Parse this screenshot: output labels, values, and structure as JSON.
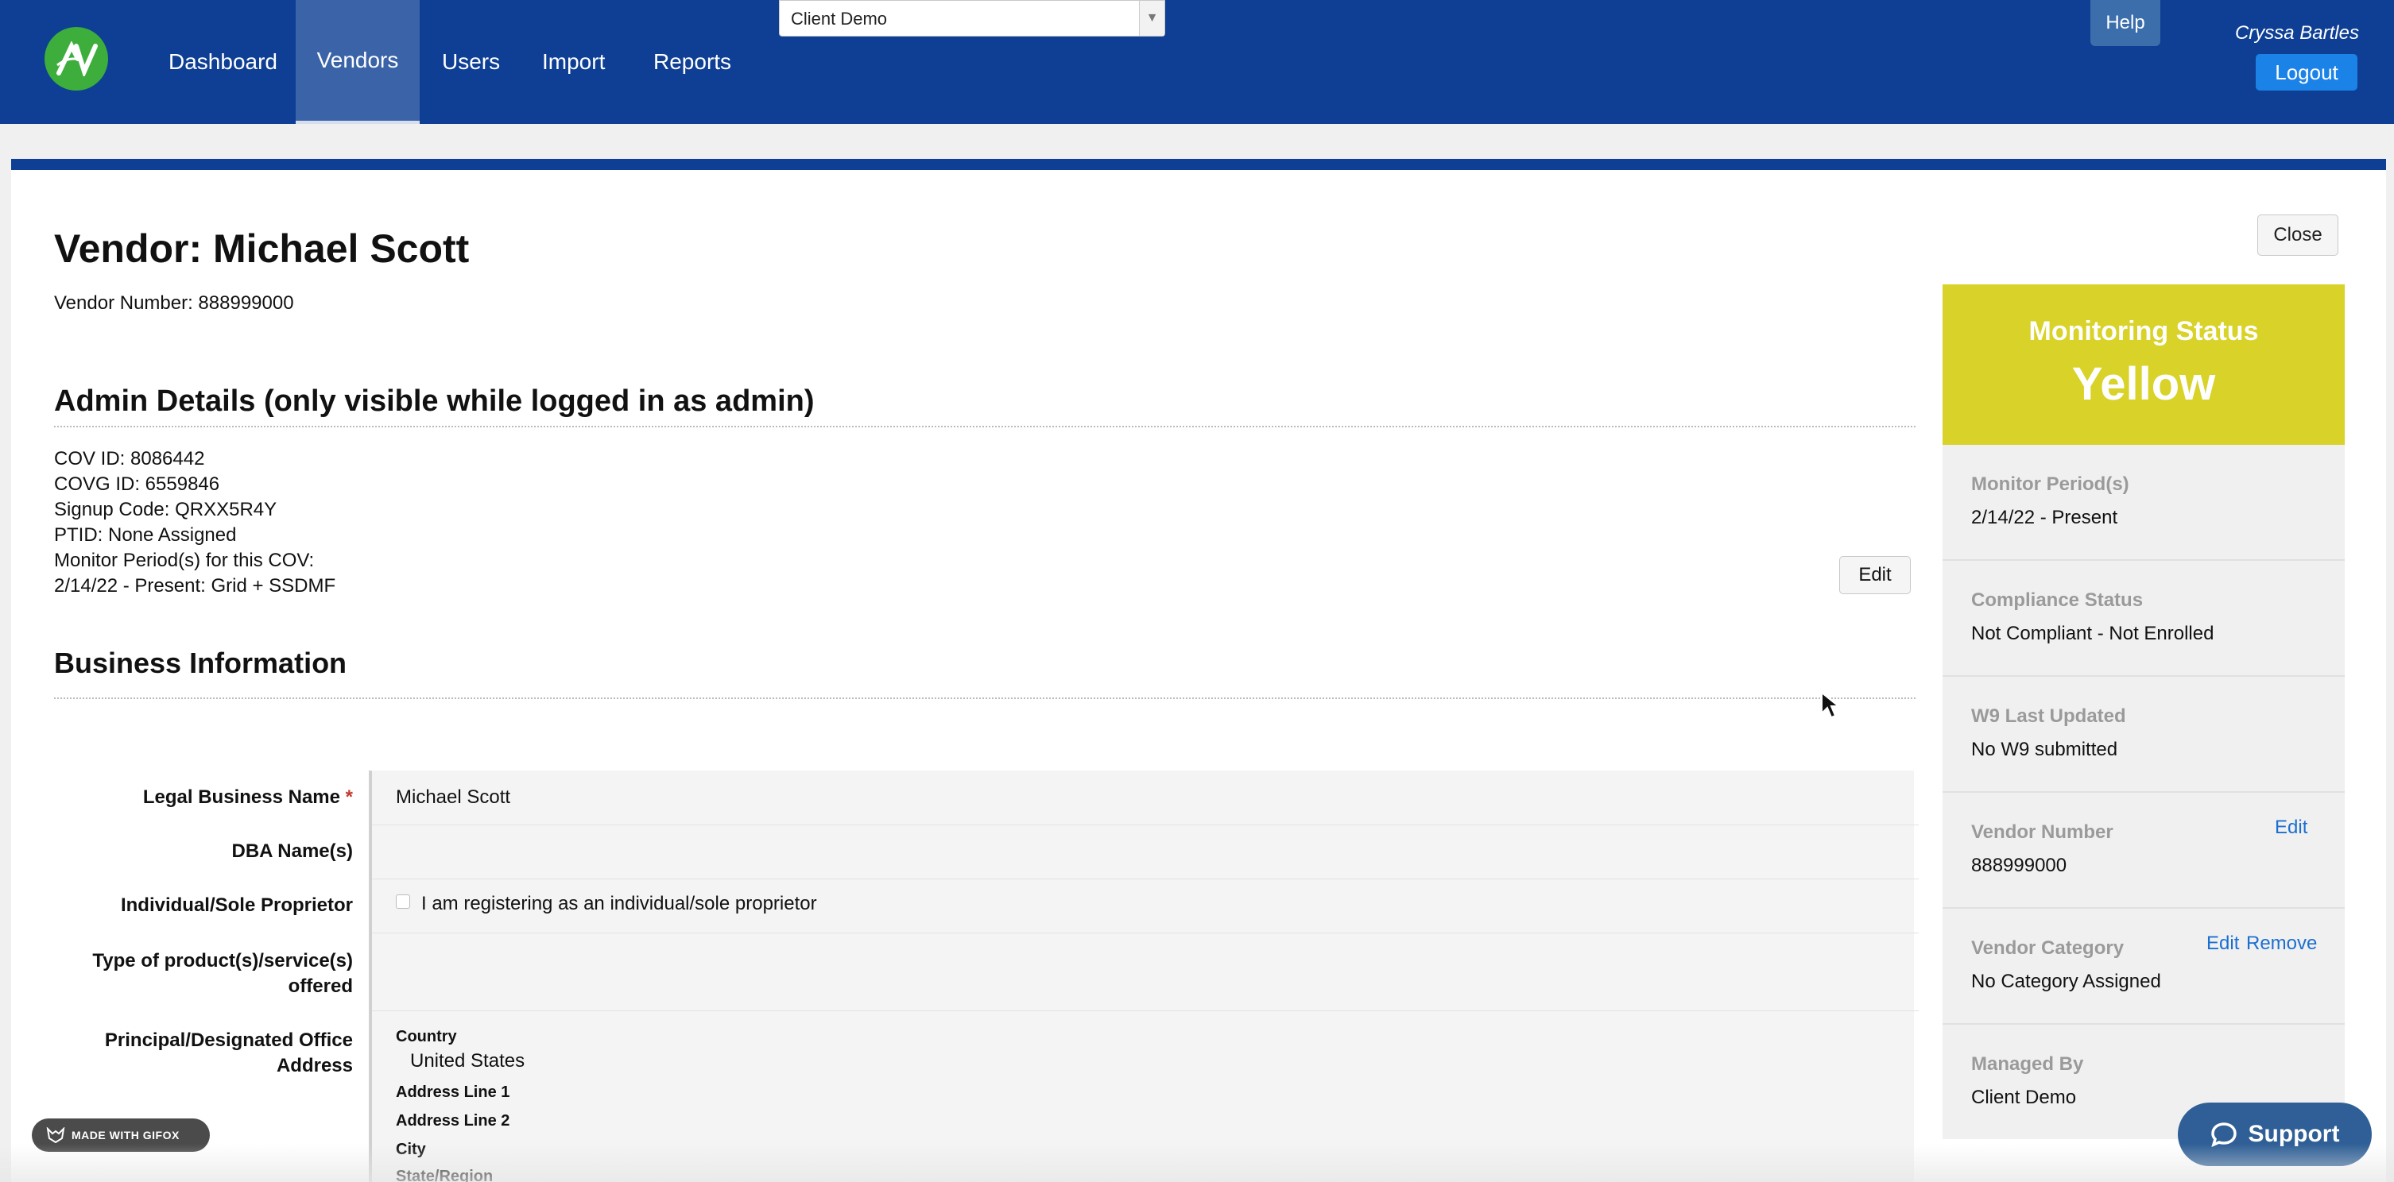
{
  "nav": {
    "items": [
      {
        "label": "Dashboard"
      },
      {
        "label": "Vendors"
      },
      {
        "label": "Users"
      },
      {
        "label": "Import"
      },
      {
        "label": "Reports"
      }
    ],
    "client_select": "Client Demo",
    "help_label": "Help",
    "user_name": "Cryssa Bartles",
    "logout_label": "Logout",
    "accent": "#0e3f94"
  },
  "page": {
    "title": "Vendor: Michael Scott",
    "close_label": "Close",
    "vendor_number_line": "Vendor Number: 888999000"
  },
  "admin": {
    "title": "Admin Details (only visible while logged in as admin)",
    "lines": [
      "COV ID: 8086442",
      "COVG ID: 6559846",
      "Signup Code: QRXX5R4Y",
      "PTID: None Assigned",
      "Monitor Period(s) for this COV:",
      "2/14/22 - Present: Grid + SSDMF"
    ]
  },
  "business": {
    "title": "Business Information",
    "edit_label": "Edit",
    "legal_name_label": "Legal Business Name",
    "required_mark": "*",
    "legal_name_value": "Michael Scott",
    "dba_label": "DBA Name(s)",
    "sole_prop_label": "Individual/Sole Proprietor",
    "sole_prop_checkbox": "I am registering as an individual/sole proprietor",
    "product_label": "Type of product(s)/service(s) offered",
    "address_label": "Principal/Designated Office Address",
    "country_label": "Country",
    "country_value": "United States",
    "address1_label": "Address Line 1",
    "address2_label": "Address Line 2",
    "city_label": "City",
    "state_label": "State/Region"
  },
  "sidebar": {
    "status_title": "Monitoring Status",
    "status_value": "Yellow",
    "status_color": "#d9d228",
    "items": [
      {
        "label": "Monitor Period(s)",
        "value": "2/14/22 - Present"
      },
      {
        "label": "Compliance Status",
        "value": "Not Compliant - Not Enrolled"
      },
      {
        "label": "W9 Last Updated",
        "value": "No W9 submitted"
      },
      {
        "label": "Vendor Number",
        "value": "888999000",
        "edit": "Edit"
      },
      {
        "label": "Vendor Category",
        "value": "No Category Assigned",
        "edit": "Edit",
        "remove": "Remove"
      },
      {
        "label": "Managed By",
        "value": "Client Demo"
      }
    ]
  },
  "overlay": {
    "gifox_label": "MADE WITH GIFOX",
    "support_label": "Support"
  }
}
